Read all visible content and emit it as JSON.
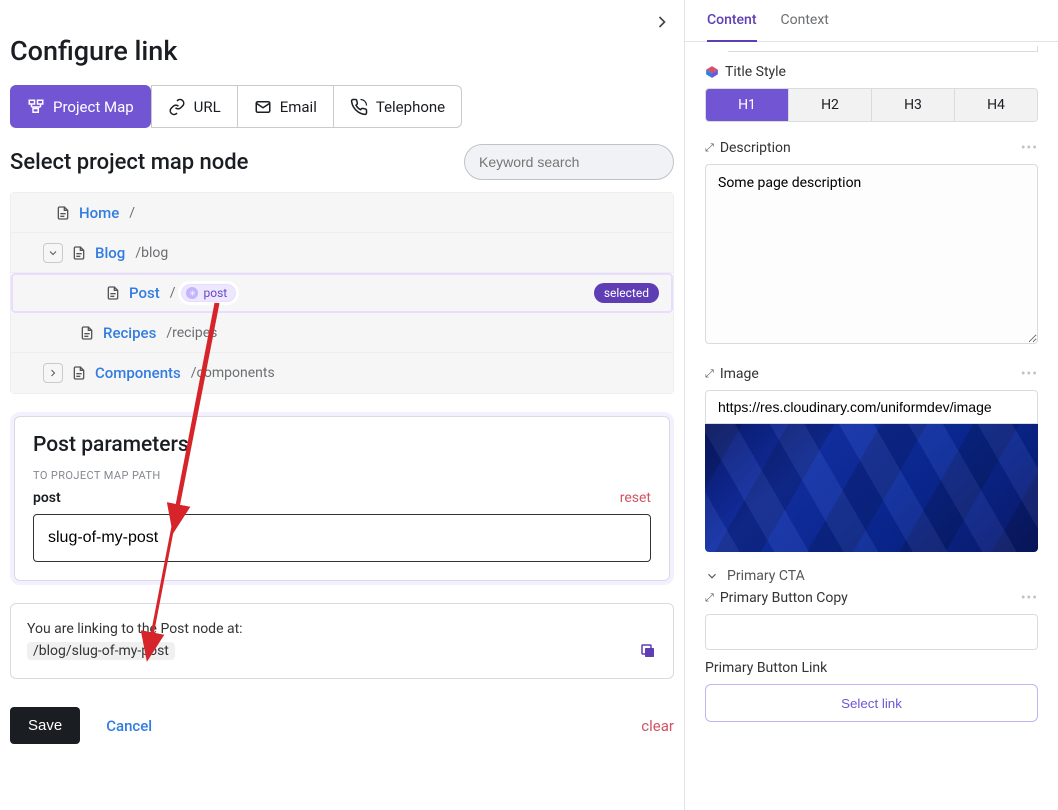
{
  "title": "Configure link",
  "tabs": {
    "projectMap": "Project Map",
    "url": "URL",
    "email": "Email",
    "telephone": "Telephone"
  },
  "selectNodeHeading": "Select project map node",
  "search": {
    "placeholder": "Keyword search"
  },
  "tree": {
    "home": {
      "label": "Home",
      "path": "/"
    },
    "blog": {
      "label": "Blog",
      "path": "/blog"
    },
    "post": {
      "label": "Post",
      "path": "/",
      "slug": "post",
      "selectedBadge": "selected"
    },
    "recipes": {
      "label": "Recipes",
      "path": "/recipes"
    },
    "components": {
      "label": "Components",
      "path": "/components"
    }
  },
  "params": {
    "heading": "Post parameters",
    "subhead": "TO PROJECT MAP PATH",
    "fieldLabel": "post",
    "resetLabel": "reset",
    "value": "slug-of-my-post"
  },
  "info": {
    "text": "You are linking to the Post node at:",
    "path": "/blog/slug-of-my-post"
  },
  "footer": {
    "save": "Save",
    "cancel": "Cancel",
    "clear": "clear"
  },
  "rightTabs": {
    "content": "Content",
    "context": "Context"
  },
  "titleStyle": {
    "label": "Title Style",
    "options": [
      "H1",
      "H2",
      "H3",
      "H4"
    ],
    "selected": "H1"
  },
  "description": {
    "label": "Description",
    "value": "Some page description"
  },
  "image": {
    "label": "Image",
    "value": "https://res.cloudinary.com/uniformdev/image"
  },
  "primaryCta": {
    "sectionLabel": "Primary CTA",
    "copyLabel": "Primary Button Copy",
    "copyValue": "",
    "linkLabel": "Primary Button Link",
    "selectLink": "Select link"
  }
}
